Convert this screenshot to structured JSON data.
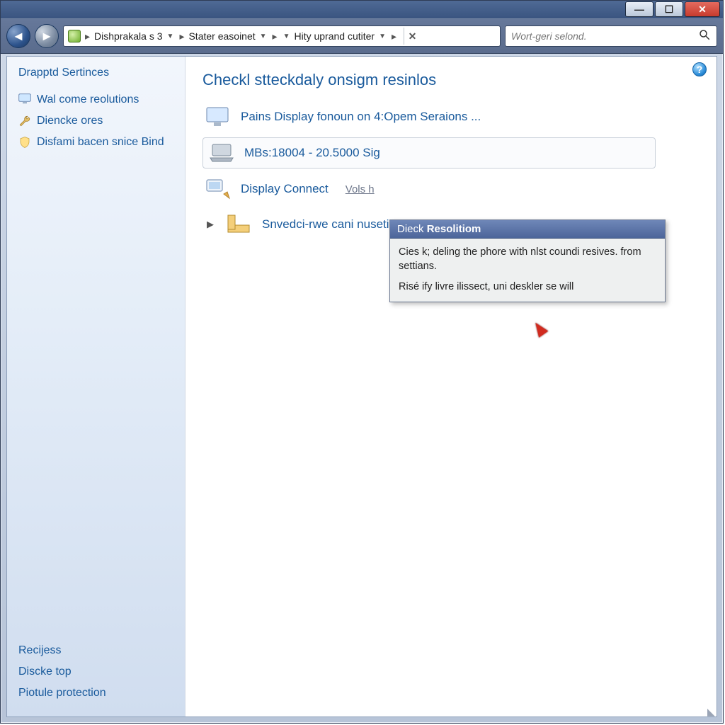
{
  "titlebar": {
    "minimize_glyph": "—",
    "maximize_glyph": "☐",
    "close_glyph": "✕"
  },
  "nav": {
    "back_glyph": "◄",
    "forward_glyph": "►"
  },
  "address": {
    "seg1": "Dishprakala s 3",
    "seg2": "Stater easoinet",
    "seg3": "Hity uprand cutiter",
    "sep": "▸",
    "drop": "▼",
    "close_glyph": "✕"
  },
  "search": {
    "placeholder": "Wort-geri selond."
  },
  "sidebar": {
    "heading": "Drapptd Sertinces",
    "items": [
      {
        "label": "Wal come reolutions"
      },
      {
        "label": "Diencke ores"
      },
      {
        "label": "Disfami bacen snice Bind"
      }
    ],
    "bottom": [
      {
        "label": "Recijess"
      },
      {
        "label": "Discke top"
      },
      {
        "label": "Piotule protection"
      }
    ]
  },
  "main": {
    "help_glyph": "?",
    "heading": "Checkl stteckdaly onsigm resinlos",
    "items": [
      {
        "label": "Pains Display fonoun on 4:Opem Seraions ...",
        "framed": false
      },
      {
        "label": "MBs:18004 - 20.5000 Sig",
        "framed": true
      },
      {
        "label": "Display Connect",
        "sub": "Vols h",
        "framed": false
      },
      {
        "label": "Snvedci-rwe cani nusetion toon",
        "ell": "....",
        "framed": false,
        "expander": true
      }
    ]
  },
  "flyout": {
    "title_prefix": "Dieck ",
    "title_bold": "Resolitiom",
    "line1": "Cies k; deling the phore with nlst coundi resives. from settians.",
    "line2": "Risé ify livre ilissect, uni deskler se will"
  }
}
